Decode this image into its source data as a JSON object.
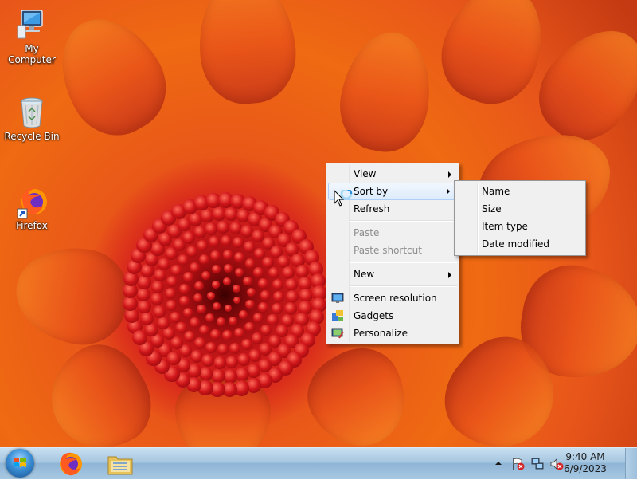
{
  "desktop": {
    "icons": [
      {
        "label": "My Computer",
        "icon": "computer-icon"
      },
      {
        "label": "Recycle Bin",
        "icon": "recycle-bin-icon"
      },
      {
        "label": "Firefox",
        "icon": "firefox-icon"
      }
    ]
  },
  "context_menu": {
    "items": [
      {
        "label": "View",
        "submenu": true
      },
      {
        "label": "Sort by",
        "submenu": true,
        "highlighted": true
      },
      {
        "label": "Refresh"
      },
      {
        "label": "Paste",
        "disabled": true
      },
      {
        "label": "Paste shortcut",
        "disabled": true
      },
      {
        "label": "New",
        "submenu": true
      },
      {
        "label": "Screen resolution",
        "icon": "screen-resolution-icon"
      },
      {
        "label": "Gadgets",
        "icon": "gadgets-icon"
      },
      {
        "label": "Personalize",
        "icon": "personalize-icon"
      }
    ]
  },
  "sort_submenu": {
    "items": [
      {
        "label": "Name"
      },
      {
        "label": "Size"
      },
      {
        "label": "Item type"
      },
      {
        "label": "Date modified"
      }
    ]
  },
  "taskbar": {
    "start_button": "start-orb-icon",
    "pinned": [
      "firefox-icon",
      "file-explorer-icon"
    ],
    "tray_icons": [
      "show-hidden-icons-arrow",
      "action-center-flag-icon",
      "network-icon",
      "volume-muted-icon"
    ],
    "clock": {
      "time": "9:40 AM",
      "date": "6/9/2023"
    }
  },
  "colors": {
    "menu_bg": "#f0f0f0",
    "menu_highlight": "#dcebfc",
    "taskbar": "#a6c6e0",
    "wallpaper_accent": "#e9531a"
  }
}
